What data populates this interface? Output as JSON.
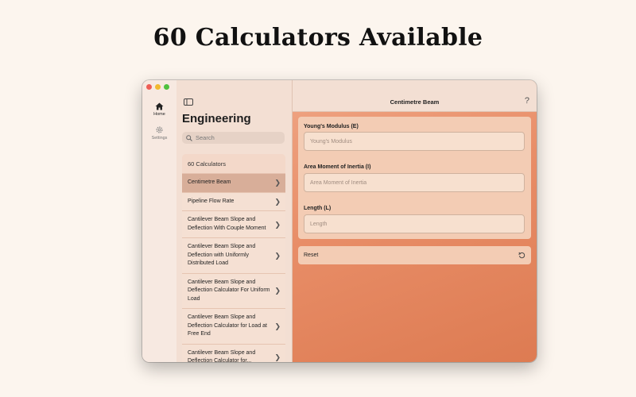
{
  "headline": "60 Calculators Available",
  "rail": {
    "home_label": "Home",
    "settings_label": "Settings"
  },
  "sidebar": {
    "title": "Engineering",
    "search_placeholder": "Search",
    "list_header": "60 Calculators",
    "items": [
      {
        "label": "Centimetre Beam",
        "selected": true
      },
      {
        "label": "Pipeline Flow Rate"
      },
      {
        "label": "Cantilever Beam Slope and Deflection With Couple Moment"
      },
      {
        "label": "Cantilever Beam Slope and Deflection with Uniformly Distributed Load"
      },
      {
        "label": "Cantilever Beam Slope and Deflection Calculator For Uniform Load"
      },
      {
        "label": "Cantilever Beam Slope and Deflection Calculator for Load at Free End"
      },
      {
        "label": "Cantilever Beam Slope and Deflection Calculator for..."
      }
    ]
  },
  "detail": {
    "title": "Centimetre Beam",
    "help_symbol": "?",
    "fields": [
      {
        "label": "Young's Modulus (E)",
        "placeholder": "Young's Modulus",
        "value": ""
      },
      {
        "label": "Area Moment of Inertia (I)",
        "placeholder": "Area Moment of Inertia",
        "value": ""
      },
      {
        "label": "Length (L)",
        "placeholder": "Length",
        "value": ""
      }
    ],
    "reset_label": "Reset"
  },
  "colors": {
    "background": "#fcf5ee",
    "accent": "#e88d67",
    "selected_row": "#d8ae99"
  },
  "icons": {
    "home": "house-icon",
    "settings": "gear-icon",
    "sidebar_toggle": "sidebar-toggle-icon",
    "search": "magnifier-icon",
    "row_chevron": "chevron-right-icon",
    "reset": "rotate-ccw-icon"
  }
}
